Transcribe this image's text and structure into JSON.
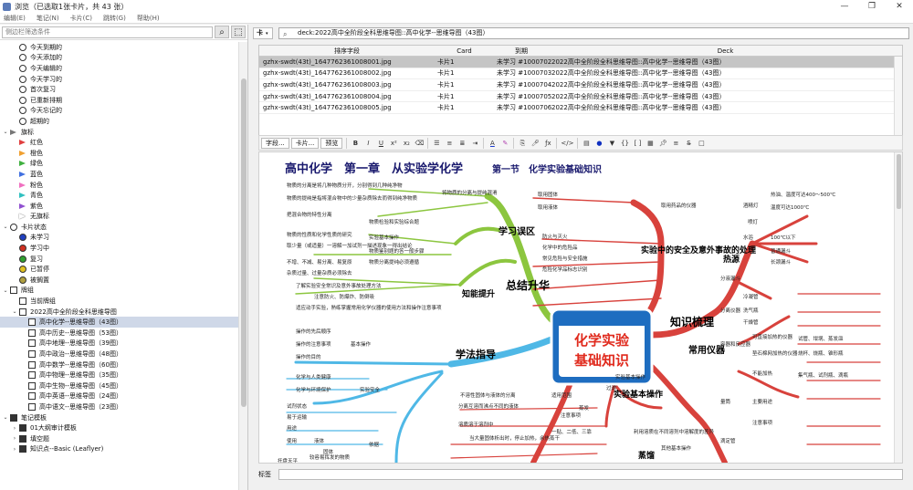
{
  "window": {
    "title": "浏览（已选取1张卡片，共 43 张）",
    "minimize": "—",
    "maximize": "❐",
    "close": "✕"
  },
  "menu": [
    "编辑(E)",
    "笔记(N)",
    "卡片(C)",
    "跳转(G)",
    "帮助(H)"
  ],
  "sidebar": {
    "search_placeholder": "侧边栏筛选条件",
    "items": [
      {
        "label": "今天到期的",
        "icon": "clock",
        "indent": 1
      },
      {
        "label": "今天添加的",
        "icon": "clock",
        "indent": 1
      },
      {
        "label": "今天编辑的",
        "icon": "clock",
        "indent": 1
      },
      {
        "label": "今天学习的",
        "icon": "clock",
        "indent": 1
      },
      {
        "label": "首次复习",
        "icon": "clock",
        "indent": 1
      },
      {
        "label": "已重新排期",
        "icon": "clock",
        "indent": 1
      },
      {
        "label": "今天忘记的",
        "icon": "clock",
        "indent": 1
      },
      {
        "label": "超期的",
        "icon": "clock",
        "indent": 1
      },
      {
        "label": "旗标",
        "icon": "flag",
        "color": "#777777",
        "indent": 0,
        "arrow": "⌄"
      },
      {
        "label": "红色",
        "icon": "flag",
        "color": "#e04040",
        "indent": 1
      },
      {
        "label": "橙色",
        "icon": "flag",
        "color": "#f0a030",
        "indent": 1
      },
      {
        "label": "绿色",
        "icon": "flag",
        "color": "#40b040",
        "indent": 1
      },
      {
        "label": "蓝色",
        "icon": "flag",
        "color": "#4070e0",
        "indent": 1
      },
      {
        "label": "粉色",
        "icon": "flag",
        "color": "#f070c0",
        "indent": 1
      },
      {
        "label": "青色",
        "icon": "flag",
        "color": "#30c0c0",
        "indent": 1
      },
      {
        "label": "紫色",
        "icon": "flag",
        "color": "#9050d0",
        "indent": 1
      },
      {
        "label": "无旗标",
        "icon": "flag",
        "color": "#ffffff",
        "indent": 1
      },
      {
        "label": "卡片状态",
        "icon": "dot",
        "color": "#ffffff",
        "indent": 0,
        "arrow": "⌄"
      },
      {
        "label": "未学习",
        "icon": "dot",
        "color": "#2040c0",
        "indent": 1
      },
      {
        "label": "学习中",
        "icon": "dot",
        "color": "#d03020",
        "indent": 1
      },
      {
        "label": "复习",
        "icon": "dot",
        "color": "#30a030",
        "indent": 1
      },
      {
        "label": "已暂停",
        "icon": "dot",
        "color": "#e0c020",
        "indent": 1
      },
      {
        "label": "被搁置",
        "icon": "dot",
        "color": "#b0a040",
        "indent": 1
      },
      {
        "label": "牌组",
        "icon": "deck",
        "indent": 0,
        "arrow": "⌄"
      },
      {
        "label": "当前牌组",
        "icon": "deck",
        "indent": 1
      },
      {
        "label": "2022高中全阶段全科思维导图",
        "icon": "deck",
        "indent": 1,
        "arrow": "⌄"
      },
      {
        "label": "高中化学--思维导图（43图）",
        "icon": "deck",
        "indent": 2,
        "selected": true
      },
      {
        "label": "高中历史--思维导图（53图）",
        "icon": "deck",
        "indent": 2
      },
      {
        "label": "高中地理--思维导图（39图）",
        "icon": "deck",
        "indent": 2
      },
      {
        "label": "高中政治--思维导图（48图）",
        "icon": "deck",
        "indent": 2
      },
      {
        "label": "高中数学--思维导图（60图）",
        "icon": "deck",
        "indent": 2
      },
      {
        "label": "高中物理--思维导图（35图）",
        "icon": "deck",
        "indent": 2
      },
      {
        "label": "高中生物--思维导图（45图）",
        "icon": "deck",
        "indent": 2
      },
      {
        "label": "高中英语--思维导图（24图）",
        "icon": "deck",
        "indent": 2
      },
      {
        "label": "高中语文--思维导图（23图）",
        "icon": "deck",
        "indent": 2
      },
      {
        "label": "笔记模板",
        "icon": "deckb",
        "indent": 0,
        "arrow": "⌄"
      },
      {
        "label": "01大纲审计模板",
        "icon": "deckb",
        "indent": 1,
        "arrow": "›"
      },
      {
        "label": "填空题",
        "icon": "deckb",
        "indent": 1,
        "arrow": "›"
      },
      {
        "label": "知识点--Basic (Leaflyer)",
        "icon": "deckb",
        "indent": 1,
        "arrow": "›"
      }
    ]
  },
  "topbar": {
    "mode_label": "卡",
    "mode_arrow": "▾",
    "search_value": "deck:2022高中全阶段全科思维导图::高中化学--思维导图（43图）",
    "search_icon": "⌕"
  },
  "table": {
    "headers": [
      "排序字段",
      "Card",
      "到期",
      "Deck"
    ],
    "rows": [
      {
        "sort": "gzhx-swdt(43t)_1647762361008001.jpg",
        "card": "卡片1",
        "due": "未学习 #1000702",
        "deck": "2022高中全阶段全科思维导图::高中化学--思维导图（43图）",
        "selected": true
      },
      {
        "sort": "gzhx-swdt(43t)_1647762361008002.jpg",
        "card": "卡片1",
        "due": "未学习 #1000703",
        "deck": "2022高中全阶段全科思维导图::高中化学--思维导图（43图）"
      },
      {
        "sort": "gzhx-swdt(43t)_1647762361008003.jpg",
        "card": "卡片1",
        "due": "未学习 #1000704",
        "deck": "2022高中全阶段全科思维导图::高中化学--思维导图（43图）"
      },
      {
        "sort": "gzhx-swdt(43t)_1647762361008004.jpg",
        "card": "卡片1",
        "due": "未学习 #1000705",
        "deck": "2022高中全阶段全科思维导图::高中化学--思维导图（43图）"
      },
      {
        "sort": "gzhx-swdt(43t)_1647762361008005.jpg",
        "card": "卡片1",
        "due": "未学习 #1000706",
        "deck": "2022高中全阶段全科思维导图::高中化学--思维导图（43图）"
      }
    ]
  },
  "editor_toolbar": {
    "fields_btn": "字段...",
    "cards_btn": "卡片...",
    "preview_btn": "预览"
  },
  "mindmap": {
    "title": "高中化学　第一章　从实验学化学",
    "section": "第一节　化学实验基础知识",
    "badge_line1": "化学实验",
    "badge_line2": "基础知识",
    "branches": {
      "study": "学习误区",
      "summary": "总结升华",
      "method": "学法指导",
      "knowledge": "知识梳理",
      "common": "常用仪器",
      "safety": "实验中的安全及意外事故的处理",
      "ability": "知能提升",
      "heat": "热源",
      "basicop": "实验基本操作",
      "steam": "蒸馏"
    },
    "texts": [
      "物质的分离是将几种物质分开，分别得到几种纯净物",
      "将物质的分离与提纯混淆",
      "物质的提纯是指将混合物中的少量杂质除去而得到纯净物质",
      "把混合物的特性分离",
      "物质检验和实验综合题",
      "物质的性质和化学性质的研究",
      "实验基本操作",
      "取少量（或适量）一溶解一加试剂一描述现象一得出结论",
      "物质鉴别题的答一般步骤",
      "不增、不减、易分离、易复原",
      "物质分离提纯必须遵循",
      "杂质过量、过量杂质必须除去",
      "了解实验安全常识及意外事故处理方法",
      "注意防火、防爆炸、防倒吸",
      "适应动手实验，熟练掌握常用化学仪器的使用方法和操作注意事项",
      "操作的先后顺序",
      "操作的注意事项",
      "操作的目的",
      "基本操作",
      "化学与人类健康",
      "化学与环境保护",
      "实验安全",
      "试剂状态",
      "易于运输",
      "用途",
      "使用",
      "液体",
      "固体",
      "依据",
      "较容易挥发的物质",
      "取用固体",
      "取用液体",
      "取用药品的仪器",
      "防火与灭火",
      "化学中的危险品",
      "常见危险与安全措施",
      "危险化学品标志识别",
      "热油、温度可达400～500℃",
      "温度可达1000℃",
      "酒精灯",
      "喷灯",
      "水浴",
      "100℃以下",
      "普通漏斗",
      "长颈漏斗",
      "分液漏斗",
      "冷凝管",
      "洗气瓶",
      "干燥管",
      "分离仪器",
      "容器和反应器",
      "可直接加热的仪器",
      "垫石棉网加热的仪器",
      "不能加热",
      "试管、坩埚、蒸发皿",
      "烧杯、烧瓶、锥形瓶",
      "集气瓶、试剂瓶、滴瓶",
      "量筒",
      "滴定管",
      "主要用途",
      "注意事项",
      "过滤",
      "蒸发",
      "实验基本操作",
      "适用范围",
      "注意事项",
      "一贴、二低、三靠",
      "不溶性固体与液体的分离",
      "分离互溶而沸点不同的液体",
      "溶质溶于溶剂中",
      "当大量固体析出时，停止加热，余热蒸干",
      "利用溶质在不同溶剂中溶解度的差异",
      "其他基本操作",
      "托盘天平"
    ]
  }
}
